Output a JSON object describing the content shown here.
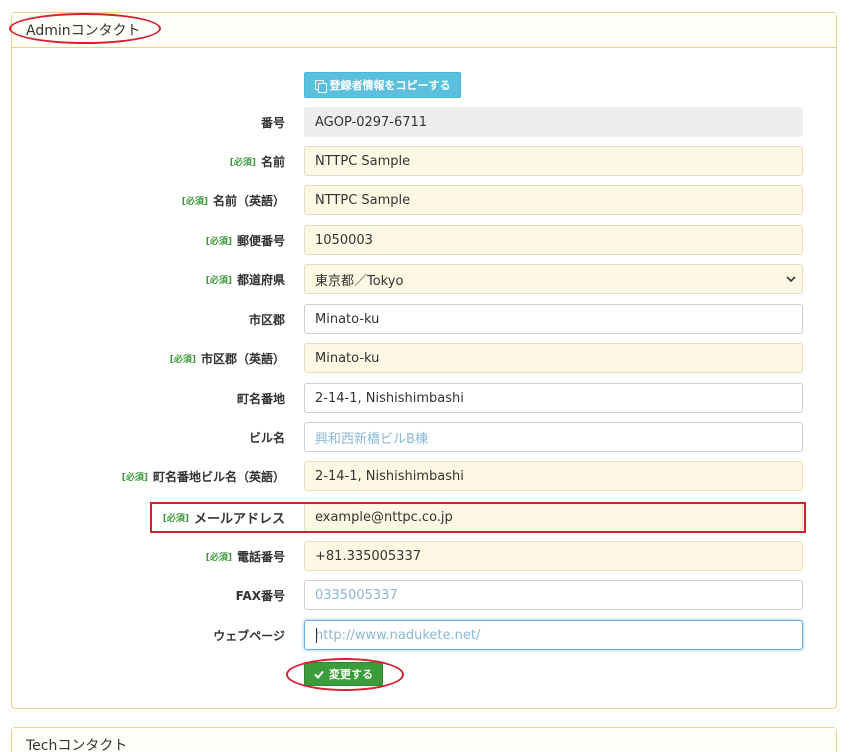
{
  "admin_panel": {
    "title": "Adminコンタクト",
    "copy_button_label": "登録者情報をコピーする",
    "submit_button_label": "変更する"
  },
  "tech_panel": {
    "title": "Techコンタクト"
  },
  "required_tag": "[必須]",
  "fields": {
    "number": {
      "label": "番号",
      "value": "AGOP-0297-6711"
    },
    "name": {
      "label": "名前",
      "value": "NTTPC Sample"
    },
    "name_en": {
      "label": "名前（英語）",
      "value": "NTTPC Sample"
    },
    "postal_code": {
      "label": "郵便番号",
      "value": "1050003"
    },
    "prefecture": {
      "label": "都道府県",
      "value": "東京都／Tokyo"
    },
    "city": {
      "label": "市区郡",
      "value": "Minato-ku"
    },
    "city_en": {
      "label": "市区郡（英語）",
      "value": "Minato-ku"
    },
    "street": {
      "label": "町名番地",
      "value": "2-14-1, Nishishimbashi"
    },
    "building": {
      "label": "ビル名",
      "placeholder": "興和西新橋ビルB棟"
    },
    "street_building_en": {
      "label": "町名番地ビル名（英語）",
      "value": "2-14-1, Nishishimbashi"
    },
    "email": {
      "label": "メールアドレス",
      "value": "example@nttpc.co.jp"
    },
    "phone": {
      "label": "電話番号",
      "value": "+81.335005337"
    },
    "fax": {
      "label": "FAX番号",
      "placeholder": "0335005337"
    },
    "webpage": {
      "label": "ウェブページ",
      "placeholder": "http://www.nadukete.net/"
    }
  },
  "colors": {
    "panel_border": "#f6cf86",
    "required_bg": "#fdf8e4",
    "required_tag": "#3c9a3c",
    "info_button": "#5bc0de",
    "success_button": "#3a9d3a",
    "annotation_red": "#d42030"
  }
}
